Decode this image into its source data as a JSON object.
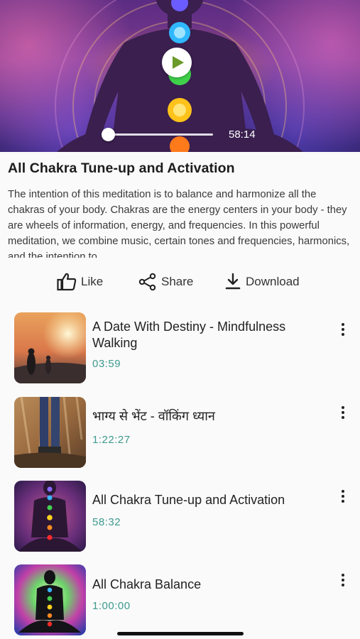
{
  "player": {
    "duration": "58:14",
    "progress": 0.0
  },
  "track": {
    "title": "All Chakra Tune-up and Activation",
    "description": "The intention of this meditation is to balance and harmonize all the chakras of your body. Chakras are the energy centers in your body - they are wheels of information, energy, and frequencies. In this powerful meditation, we combine music, certain tones and frequencies, harmonics, and the intention to"
  },
  "actions": {
    "like": "Like",
    "share": "Share",
    "download": "Download"
  },
  "playlist": [
    {
      "title": "A Date With Destiny - Mindfulness Walking",
      "duration": "03:59"
    },
    {
      "title": "भाग्य से भेंट - वॉकिंग ध्यान",
      "duration": "1:22:27"
    },
    {
      "title": "All Chakra Tune-up and Activation",
      "duration": "58:32"
    },
    {
      "title": "All Chakra Balance",
      "duration": "1:00:00"
    }
  ],
  "colors": {
    "accent_duration": "#3d9a8e",
    "background": "#fafafa"
  },
  "icons": {
    "play": "play-icon",
    "like": "thumbs-up-icon",
    "share": "share-icon",
    "download": "download-icon",
    "more": "more-vertical-icon"
  }
}
